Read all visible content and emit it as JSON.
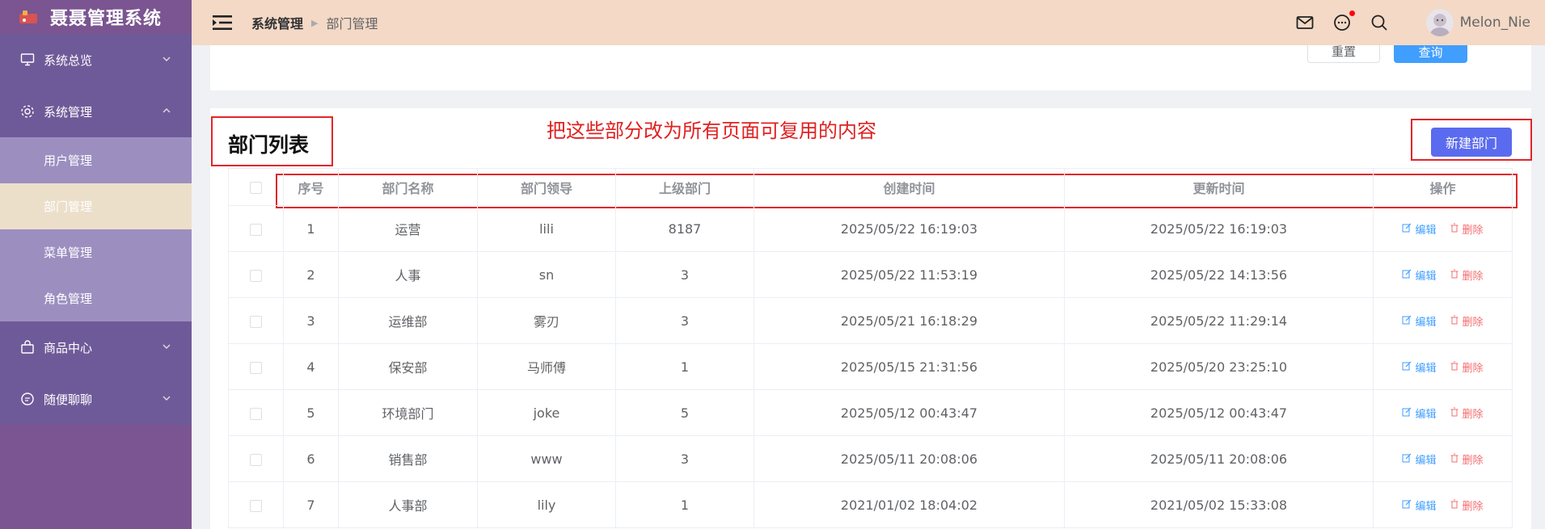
{
  "app": {
    "title": "聂聂管理系统",
    "logo": "cart-logo-icon"
  },
  "sidebar": {
    "groups": [
      {
        "label": "系统总览",
        "icon": "monitor-icon",
        "expanded": false
      },
      {
        "label": "系统管理",
        "icon": "gear-icon",
        "expanded": true
      },
      {
        "label": "商品中心",
        "icon": "bag-icon",
        "expanded": false
      },
      {
        "label": "随便聊聊",
        "icon": "chat-icon",
        "expanded": false
      }
    ],
    "subitems": [
      "用户管理",
      "部门管理",
      "菜单管理",
      "角色管理"
    ],
    "active_sub": "部门管理"
  },
  "header": {
    "breadcrumb": [
      "系统管理",
      "部门管理"
    ],
    "username": "Melon_Nie",
    "icons": [
      "mail-icon",
      "message-icon",
      "search-icon"
    ]
  },
  "search": {
    "reset_label": "重置",
    "query_label": "查询"
  },
  "list": {
    "title": "部门列表",
    "new_button": "新建部门",
    "annotation": "把这些部分改为所有页面可复用的内容",
    "columns": [
      "序号",
      "部门名称",
      "部门领导",
      "上级部门",
      "创建时间",
      "更新时间",
      "操作"
    ],
    "edit_label": "编辑",
    "delete_label": "删除",
    "rows": [
      {
        "no": "1",
        "name": "运营",
        "leader": "lili",
        "parent": "8187",
        "created": "2025/05/22 16:19:03",
        "updated": "2025/05/22 16:19:03"
      },
      {
        "no": "2",
        "name": "人事",
        "leader": "sn",
        "parent": "3",
        "created": "2025/05/22 11:53:19",
        "updated": "2025/05/22 14:13:56"
      },
      {
        "no": "3",
        "name": "运维部",
        "leader": "雾刃",
        "parent": "3",
        "created": "2025/05/21 16:18:29",
        "updated": "2025/05/22 11:29:14"
      },
      {
        "no": "4",
        "name": "保安部",
        "leader": "马师傅",
        "parent": "1",
        "created": "2025/05/15 21:31:56",
        "updated": "2025/05/20 23:25:10"
      },
      {
        "no": "5",
        "name": "环境部门",
        "leader": "joke",
        "parent": "5",
        "created": "2025/05/12 00:43:47",
        "updated": "2025/05/12 00:43:47"
      },
      {
        "no": "6",
        "name": "销售部",
        "leader": "www",
        "parent": "3",
        "created": "2025/05/11 20:08:06",
        "updated": "2025/05/11 20:08:06"
      },
      {
        "no": "7",
        "name": "人事部",
        "leader": "lily",
        "parent": "1",
        "created": "2021/01/02 18:04:02",
        "updated": "2021/05/02 15:33:08"
      }
    ]
  },
  "colors": {
    "sidebar": "#7b5592",
    "header": "#f3d9c6",
    "primary": "#5b6bef",
    "annotation": "#e0262a"
  }
}
